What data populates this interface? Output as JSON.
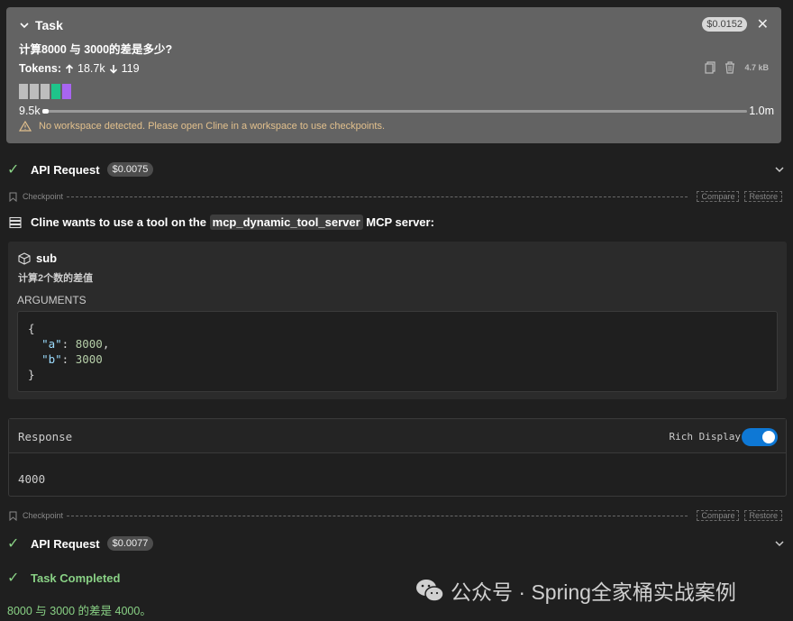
{
  "task": {
    "header_label": "Task",
    "cost": "$0.0152",
    "close_glyph": "✕",
    "question": "计算8000 与 3000的差是多少?",
    "tokens_label": "Tokens:",
    "tokens_up": "18.7k",
    "tokens_down": "119",
    "size": "4.7 kB",
    "context_min": "9.5k",
    "context_max": "1.0m",
    "context_fraction": 0.0095,
    "block_colors": [
      "#bdbdbd",
      "#bdbdbd",
      "#bdbdbd",
      "#1fc48a",
      "#a865f0"
    ],
    "warning": "No workspace detected. Please open Cline in a workspace to use checkpoints."
  },
  "api_request_1": {
    "label": "API Request",
    "cost": "$0.0075"
  },
  "checkpoint_1": {
    "label": "Checkpoint",
    "compare": "Compare",
    "restore": "Restore"
  },
  "tool_request": {
    "prefix": "Cline wants to use a tool on the",
    "server": "mcp_dynamic_tool_server",
    "suffix": "MCP server:"
  },
  "tool": {
    "name": "sub",
    "description": "计算2个数的差值",
    "arguments_label": "ARGUMENTS",
    "args_open": "{",
    "arg_a_key": "\"a\"",
    "arg_a_value": "8000",
    "arg_b_key": "\"b\"",
    "arg_b_value": "3000",
    "args_close": "}"
  },
  "response": {
    "title": "Response",
    "rich_display_label": "Rich Display",
    "rich_display_on": true,
    "value": "4000"
  },
  "checkpoint_2": {
    "label": "Checkpoint",
    "compare": "Compare",
    "restore": "Restore"
  },
  "api_request_2": {
    "label": "API Request",
    "cost": "$0.0077"
  },
  "completion": {
    "label": "Task Completed",
    "result": "8000 与 3000 的差是 4000。"
  },
  "watermark": {
    "text": "公众号 · Spring全家桶实战案例"
  },
  "colors": {
    "accent_green": "#89d185",
    "toggle_blue": "#0e78d5",
    "warning": "#e2c08d"
  }
}
